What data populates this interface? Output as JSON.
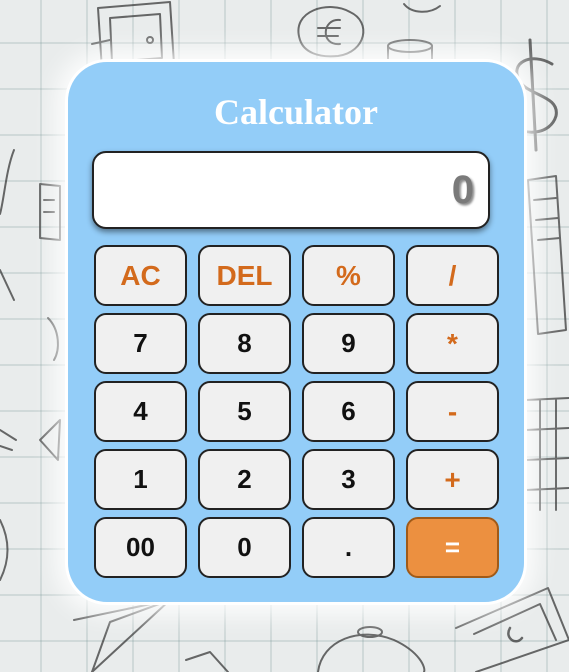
{
  "title": "Calculator",
  "display": {
    "value": "0"
  },
  "keys": [
    [
      {
        "label": "AC",
        "kind": "op"
      },
      {
        "label": "DEL",
        "kind": "op"
      },
      {
        "label": "%",
        "kind": "op"
      },
      {
        "label": "/",
        "kind": "op"
      }
    ],
    [
      {
        "label": "7",
        "kind": "num"
      },
      {
        "label": "8",
        "kind": "num"
      },
      {
        "label": "9",
        "kind": "num"
      },
      {
        "label": "*",
        "kind": "op"
      }
    ],
    [
      {
        "label": "4",
        "kind": "num"
      },
      {
        "label": "5",
        "kind": "num"
      },
      {
        "label": "6",
        "kind": "num"
      },
      {
        "label": "-",
        "kind": "op"
      }
    ],
    [
      {
        "label": "1",
        "kind": "num"
      },
      {
        "label": "2",
        "kind": "num"
      },
      {
        "label": "3",
        "kind": "num"
      },
      {
        "label": "+",
        "kind": "op"
      }
    ],
    [
      {
        "label": "00",
        "kind": "num"
      },
      {
        "label": "0",
        "kind": "num"
      },
      {
        "label": ".",
        "kind": "num"
      },
      {
        "label": "=",
        "kind": "equals"
      }
    ]
  ],
  "colors": {
    "panel": "#93cdf8",
    "operator_text": "#d36a1c",
    "equals_bg": "#ec9040",
    "key_bg": "#f0f0f0"
  }
}
